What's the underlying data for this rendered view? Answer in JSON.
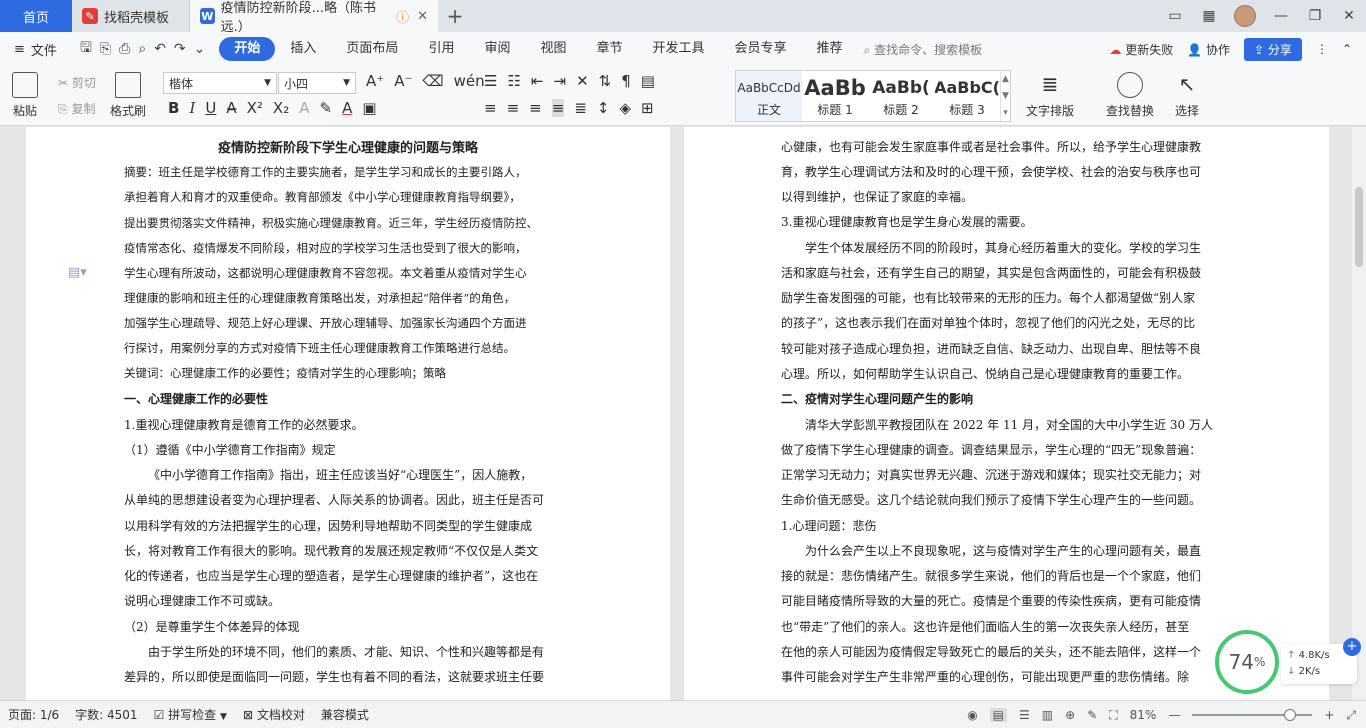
{
  "tabs": {
    "home": "首页",
    "template": "找稻壳模板",
    "doc": "疫情防控新阶段...略（陈书远.）"
  },
  "menu": {
    "file": "文件",
    "tabs": [
      "开始",
      "插入",
      "页面布局",
      "引用",
      "审阅",
      "视图",
      "章节",
      "开发工具",
      "会员专享",
      "推荐"
    ],
    "search": "查找命令、搜索模板",
    "sync": "更新失败",
    "collab": "协作",
    "share": "分享"
  },
  "ribbon": {
    "paste": "粘贴",
    "cut": "剪切",
    "copy": "复制",
    "format_painter": "格式刷",
    "font_name": "楷体",
    "font_size": "小四",
    "styles": [
      {
        "preview": "AaBbCcDd",
        "label": "正文"
      },
      {
        "preview": "AaBb",
        "label": "标题 1"
      },
      {
        "preview": "AaBb(",
        "label": "标题 2"
      },
      {
        "preview": "AaBbC(",
        "label": "标题 3"
      }
    ],
    "text_layout": "文字排版",
    "find_replace": "查找替换",
    "select": "选择"
  },
  "doc_left": {
    "title": "疫情防控新阶段下学生心理健康的问题与策略",
    "lines": [
      "摘要：班主任是学校德育工作的主要实施者，是学生学习和成长的主要引路人，",
      "承担着育人和育才的双重使命。教育部颁发《中小学心理健康教育指导纲要》，",
      "提出要贯彻落实文件精神，积极实施心理健康教育。近三年，学生经历疫情防控、",
      "疫情常态化、疫情爆发不同阶段，相对应的学校学习生活也受到了很大的影响，",
      "学生心理有所波动，这都说明心理健康教育不容忽视。本文着重从疫情对学生心",
      "理健康的影响和班主任的心理健康教育策略出发，对承担起“陪伴者”的角色，",
      "加强学生心理疏导、规范上好心理课、开放心理辅导、加强家长沟通四个方面进",
      "行探讨，用案例分享的方式对疫情下班主任心理健康教育工作策略进行总结。",
      "关键词：心理健康工作的必要性；疫情对学生的心理影响；策略"
    ],
    "h1": "一、心理健康工作的必要性",
    "l1": "1.重视心理健康教育是德育工作的必然要求。",
    "l2": "（1）遵循《中小学德育工作指南》规定",
    "para1": [
      "《中小学德育工作指南》指出，班主任应该当好“心理医生”，因人施教，",
      "从单纯的思想建设者变为心理护理者、人际关系的协调者。因此，班主任是否可",
      "以用科学有效的方法把握学生的心理，因势利导地帮助不同类型的学生健康成",
      "长，将对教育工作有很大的影响。现代教育的发展还规定教师“不仅仅是人类文",
      "化的传递者，也应当是学生心理的塑造者，是学生心理健康的维护者”，这也在",
      "说明心理健康工作不可或缺。"
    ],
    "l3": "（2）是尊重学生个体差异的体现",
    "para2": [
      "由于学生所处的环境不同，他们的素质、才能、知识、个性和兴趣等都是有",
      "差异的，所以即使是面临同一问题，学生也有着不同的看法，这就要求班主任要"
    ]
  },
  "doc_right": {
    "lines_a": [
      "心健康，也有可能会发生家庭事件或者是社会事件。所以，给予学生心理健康教",
      "育，教学生心理调试方法和及时的心理干预，会使学校、社会的治安与秩序也可",
      "以得到维护，也保证了家庭的幸福。",
      "3.重视心理健康教育也是学生身心发展的需要。",
      "学生个体发展经历不同的阶段时，其身心经历着重大的变化。学校的学习生",
      "活和家庭与社会，还有学生自己的期望，其实是包含两面性的，可能会有积极鼓",
      "励学生奋发图强的可能，也有比较带来的无形的压力。每个人都渴望做“别人家",
      "的孩子”，这也表示我们在面对单独个体时，忽视了他们的闪光之处，无尽的比",
      "较可能对孩子造成心理负担，进而缺乏自信、缺乏动力、出现自卑、胆怯等不良",
      "心理。所以，如何帮助学生认识自己、悦纳自己是心理健康教育的重要工作。"
    ],
    "h2": "二、疫情对学生心理问题产生的影响",
    "lines_b": [
      "清华大学彭凯平教授团队在 2022 年 11 月，对全国的大中小学生近 30 万人",
      "做了疫情下学生心理健康的调查。调查结果显示，学生心理的“四无”现象普遍：",
      "正常学习无动力；对真实世界无兴趣、沉迷于游戏和媒体；现实社交无能力；对",
      "生命价值无感受。这几个结论就向我们预示了疫情下学生心理产生的一些问题。",
      "1.心理问题：悲伤",
      "为什么会产生以上不良现象呢，这与疫情对学生产生的心理问题有关，最直",
      "接的就是：悲伤情绪产生。就很多学生来说，他们的背后也是一个个家庭，他们",
      "可能目睹疫情所导致的大量的死亡。疫情是个重要的传染性疾病，更有可能疫情",
      "也“带走”了他们的亲人。这也许是他们面临人生的第一次丧失亲人经历，甚至",
      "在他的亲人可能因为疫情假定导致死亡的最后的关头，还不能去陪伴，这样一个",
      "事件可能会对学生产生非常严重的心理创伤，可能出现更严重的悲伤情绪。除"
    ]
  },
  "net": {
    "percent": "74",
    "unit": "%",
    "up": "4.8K/s",
    "down": "2K/s"
  },
  "status": {
    "page": "页面: 1/6",
    "words": "字数: 4501",
    "spell": "拼写检查",
    "proof": "文档校对",
    "compat": "兼容模式",
    "zoom": "81%"
  }
}
